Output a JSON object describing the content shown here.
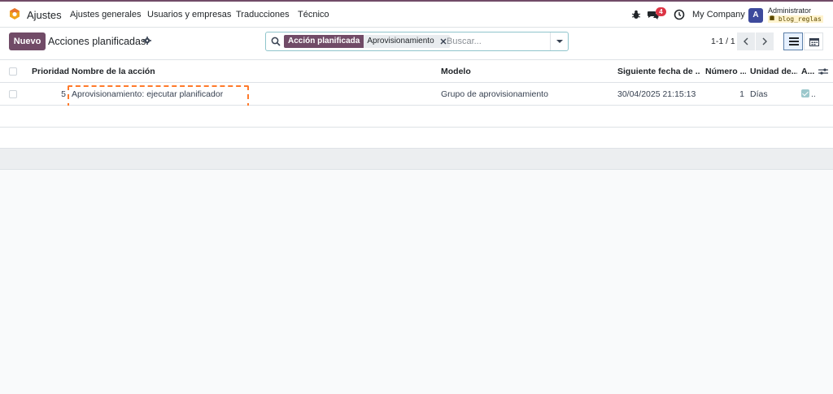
{
  "topbar": {
    "app_name": "Ajustes",
    "menu": [
      "Ajustes generales",
      "Usuarios y empresas",
      "Traducciones",
      "Técnico"
    ],
    "messages_count": "4",
    "company": "My Company",
    "user_initial": "A",
    "user_name": "Administrator",
    "database": "blog_reglas"
  },
  "control": {
    "new_button": "Nuevo",
    "title": "Acciones planificadas",
    "search": {
      "facet_label": "Acción planificada",
      "facet_value": "Aprovisionamiento",
      "placeholder": "Buscar..."
    },
    "pager": "1-1 / 1"
  },
  "list": {
    "columns": {
      "priority": "Prioridad",
      "name": "Nombre de la acción",
      "model": "Modelo",
      "next_date": "Siguiente fecha de ...",
      "number": "Número ...",
      "unit": "Unidad de...",
      "active": "A..."
    },
    "rows": [
      {
        "priority": "5",
        "name": "Aprovisionamiento: ejecutar planificador",
        "model": "Grupo de aprovisionamiento",
        "next_date": "30/04/2025 21:15:13",
        "number": "1",
        "unit": "Días",
        "active_more": ".."
      }
    ]
  },
  "colors": {
    "brand": "#714b67",
    "badge": "#dc3545",
    "highlight": "#ff7a2b"
  }
}
